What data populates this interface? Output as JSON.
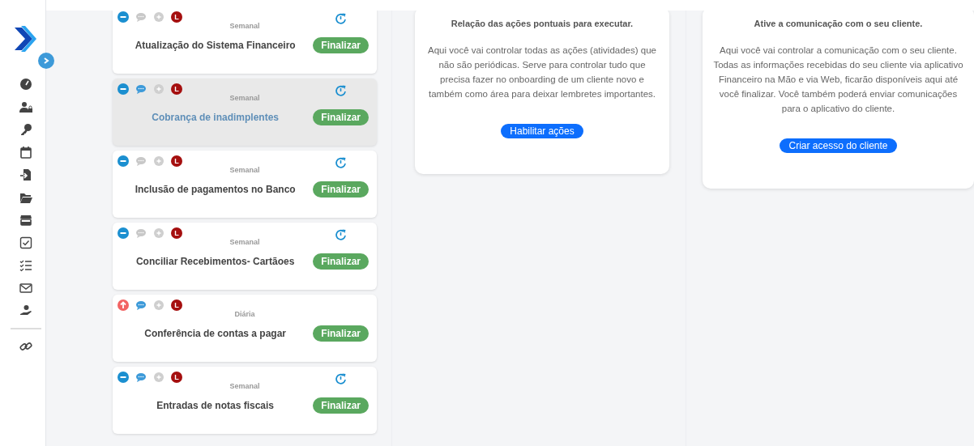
{
  "sidebar": {
    "items": [
      {
        "kind": "gauge"
      },
      {
        "kind": "user-lock"
      },
      {
        "kind": "key"
      },
      {
        "kind": "calendar"
      },
      {
        "kind": "file-import"
      },
      {
        "kind": "folder"
      },
      {
        "kind": "store"
      },
      {
        "kind": "checkbox"
      },
      {
        "kind": "checklist"
      },
      {
        "kind": "mail"
      },
      {
        "kind": "hand-dollar"
      },
      {
        "kind": "divider"
      },
      {
        "kind": "link"
      }
    ]
  },
  "tasks": [
    {
      "kind": "normal",
      "has_comments": false,
      "badge": "L",
      "frequency": "Semanal",
      "recurring": true,
      "title": "Atualização do Sistema Financeiro",
      "button": "Finalizar",
      "selected": false
    },
    {
      "kind": "normal",
      "has_comments": true,
      "badge": "L",
      "frequency": "Semanal",
      "recurring": true,
      "title": "Cobrança de inadimplentes",
      "button": "Finalizar",
      "selected": true
    },
    {
      "kind": "normal",
      "has_comments": false,
      "badge": "L",
      "frequency": "Semanal",
      "recurring": true,
      "title": "Inclusão de pagamentos no Banco",
      "button": "Finalizar",
      "selected": false
    },
    {
      "kind": "normal",
      "has_comments": false,
      "badge": "L",
      "frequency": "Semanal",
      "recurring": true,
      "title": "Conciliar Recebimentos- Cartãoes",
      "button": "Finalizar",
      "selected": false
    },
    {
      "kind": "high",
      "has_comments": true,
      "badge": "L",
      "frequency": "Diária",
      "recurring": false,
      "title": "Conferência de contas a pagar",
      "button": "Finalizar",
      "selected": false
    },
    {
      "kind": "normal",
      "has_comments": true,
      "badge": "L",
      "frequency": "Semanal",
      "recurring": true,
      "title": "Entradas de notas fiscais",
      "button": "Finalizar",
      "selected": false
    }
  ],
  "panels": [
    {
      "title": "Relação das ações pontuais para executar.",
      "text": "Aqui você vai controlar todas as ações (atividades) que não são periódicas. Serve para controlar tudo que precisa fazer no onboarding de um cliente novo e também como área para deixar lembretes importantes.",
      "button": "Habilitar ações"
    },
    {
      "title": "Ative a comunicação com o seu cliente.",
      "text": "Aqui você vai controlar a comunicação com o seu cliente. Todas as informações recebidas do seu cliente via aplicativo Financeiro na Mão e via Web, ficarão disponíveis aqui até você finalizar. Você também poderá enviar comunicações para o aplicativo do cliente.",
      "button": "Criar acesso do cliente"
    }
  ]
}
